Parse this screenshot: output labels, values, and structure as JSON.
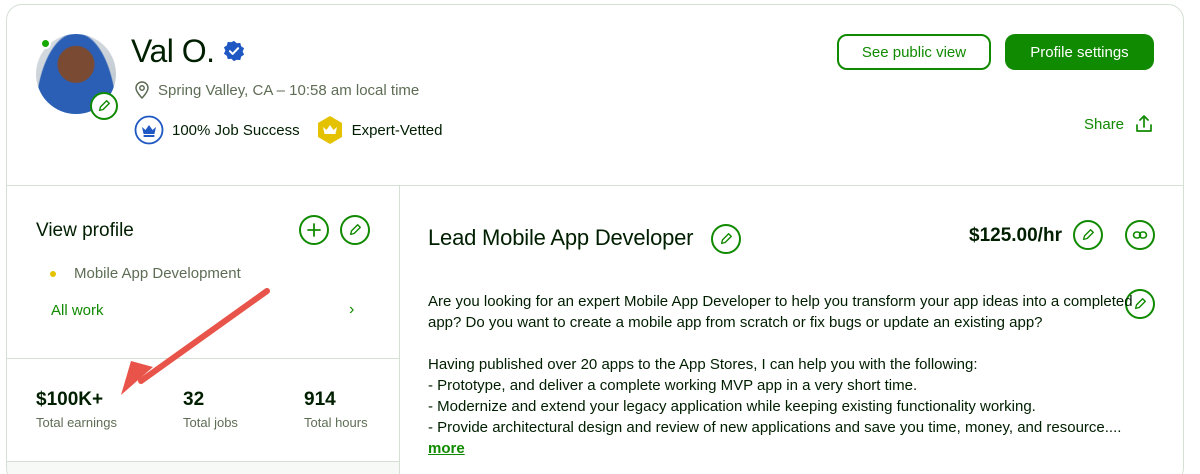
{
  "header": {
    "name": "Val O.",
    "location": "Spring Valley, CA – 10:58 am local time",
    "badges": [
      {
        "label": "100% Job Success",
        "icon": "crown-shield-icon"
      },
      {
        "label": "Expert-Vetted",
        "icon": "crown-hexagon-icon"
      }
    ],
    "see_public_view": "See public view",
    "profile_settings": "Profile settings",
    "share": "Share"
  },
  "sidebar": {
    "view_profile": "View profile",
    "skills": [
      "Mobile App Development"
    ],
    "all_work": "All work",
    "stats": [
      {
        "value": "$100K+",
        "label": "Total earnings"
      },
      {
        "value": "32",
        "label": "Total jobs"
      },
      {
        "value": "914",
        "label": "Total hours"
      }
    ]
  },
  "main": {
    "title": "Lead Mobile App Developer",
    "rate": "$125.00/hr",
    "description": {
      "line1": "Are you looking for an expert Mobile App Developer to help you transform your app ideas into a completed",
      "line2": "app? Do you want to create a mobile app from scratch or fix bugs or update an existing app?",
      "line3": "Having published over 20 apps to the App Stores, I can help you with the following:",
      "line4": "- Prototype, and deliver a complete working MVP app in a very short time.",
      "line5": "- Modernize and extend your legacy application while keeping existing functionality working.",
      "line6": "- Provide architectural design and review of new applications and save you time, money, and resource...."
    },
    "more": "more"
  },
  "colors": {
    "brand_green": "#108a00",
    "text_dark": "#001e00",
    "text_muted": "#5e6d55",
    "annotation_arrow": "#e8544a",
    "verified_blue": "#1f57c3",
    "expert_gold": "#e4c200"
  }
}
